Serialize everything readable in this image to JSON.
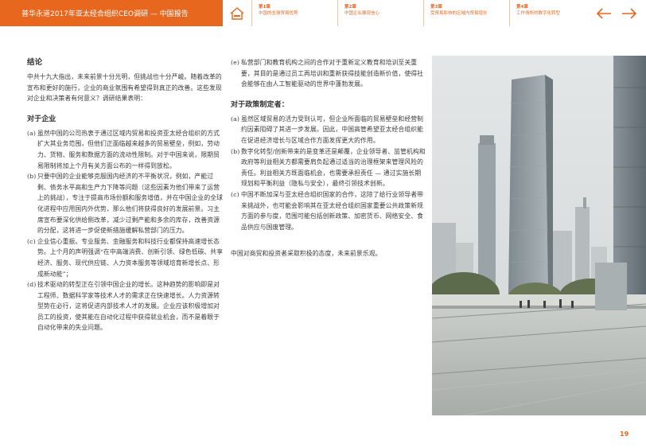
{
  "header": {
    "title": "普华永道2017年亚太经合组织CEO调研 — 中国报告",
    "tabs": [
      {
        "chapter": "第1章",
        "label": "中国的全球贸易优势"
      },
      {
        "chapter": "第2章",
        "label": "中国企业展现信心"
      },
      {
        "chapter": "第3章",
        "label": "受贸易影响的区域内贸易增长"
      },
      {
        "chapter": "第4章",
        "label": "工作场所的数字化转型"
      }
    ]
  },
  "left": {
    "heading": "结论",
    "intro": "中共十九大指出，未来前景十分光明，但挑战也十分严峻。随着改革的宣布和更好的施行，企业的商业氛围有希望得到真正的改善。这些发现对企业和决策者有何意义？调研结果表明：",
    "subheading": "对于企业",
    "items": [
      {
        "label": "(a)",
        "text": "虽然中国的公司热衷于通过区域内贸易和投资亚太经合组织的方式扩大其业务范围，但他们正面临越来越多的贸易壁垒，例如，劳动力、货物、服务和数据方面的流动性限制。对于中国来说，限期贸易限制将加上个月有关方面公布的一样得到放松。"
      },
      {
        "label": "(b)",
        "text": "只要中国的企业能够克服国内经济的不平衡状况，例如，产能过剩、债务水平高和生产力下降等问题（这些因素为他们带来了运营上的挑战），专注于提高市场份额和服务增值，并在中国企业的全球化进程中应用国内外优势，那么他们将获得良好的发展前景。习主席宣布要深化供给侧改革，减少过剩产能和多余的库存，改善资源的分配，这将进一步促使新措施缓解私营部门的压力。"
      },
      {
        "label": "(c)",
        "text": "企业信心重振。专业服务、金融服务和科技行业都保持高速增长态势。上个月的声明强调“在中高端消费、创新引领、绿色低碳、共享经济、服务、现代供应链、人力资本服务等领域培育新增长点、形成新动能”；"
      },
      {
        "label": "(d)",
        "text": "技术驱动的转型正在引领中国企业的增长。这种趋势的影响即是对工程师、数据科学家等技术人才的需求正在快速增长。人力资源转型势在必行，这将促进内部技术人才的发展。企业应该积极增加对员工的投资，使其能在自动化过程中获得就业机会，而不是着眼于自动化带来的失业问题。"
      }
    ]
  },
  "right": {
    "item_e": {
      "label": "(e)",
      "text": "私营部门和教育机构之间的合作对于重新定义教育和培训至关重要，其目的是通过员工再培训和重新获得技能创造新价值，使得社会能够在由人工智能驱动的世界中蓬勃发展。"
    },
    "subheading": "对于政策制定者：",
    "items": [
      {
        "label": "(a)",
        "text": "虽然区域贸易的活力受到认可，但企业所面临的贸易壁垒和经营制约因素阻碍了其进一步发展。因此，中国高管希望亚太经合组织能在促进经济增长与区域合作方面发挥更大的作用。"
      },
      {
        "label": "(b)",
        "text": "数字化转型/创新带来的是变革还是颠覆，企业领导者、监管机构和政府等利益相关方都需要肩负起通过适当的治理框架来管理风险的责任。利益相关方既面临机会，也需要承担责任 — 通过实施长期规划和平衡利益（隐私与安全），最终引领技术创新。"
      },
      {
        "label": "(c)",
        "text": "中国不断加深与亚太经合组织国家的合作，这除了给行业领导者带来挑战外，也可能会影响其在亚太经合组织国家重要公共政策新规方面的参与度，范围可能包括创新政策、加密货币、网络安全、食品供应与国废管理。"
      }
    ],
    "closing": "中国对商贸和投资者采取积极的态度，未来前景乐观。"
  },
  "page_number": "19",
  "colors": {
    "accent": "#e8671e"
  }
}
